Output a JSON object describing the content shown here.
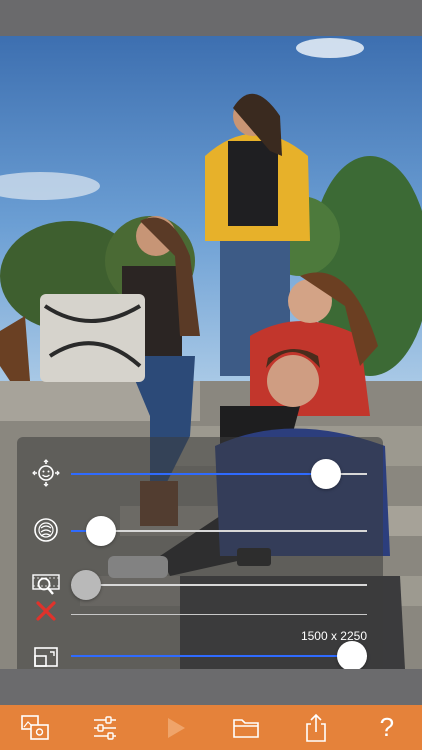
{
  "colors": {
    "toolbar_bg": "#e5823a",
    "slider_fill": "#2f6bff",
    "slider_track": "#d8d8d8",
    "panel_bg": "rgba(60,60,60,0.55)"
  },
  "photo": {
    "icon": "photo-image"
  },
  "sliders": [
    {
      "icon": "face-detect-icon",
      "level": 0.86,
      "enabled": true
    },
    {
      "icon": "skin-smooth-icon",
      "level": 0.1,
      "enabled": true
    },
    {
      "icon": "zoom-crop-icon",
      "level": 0.0,
      "enabled": false
    },
    {
      "icon": "resize-icon",
      "level": 0.95,
      "enabled": true
    }
  ],
  "disabled_marker": "x-mark-icon",
  "dimensions_label": "1500 x 2250",
  "toolbar": {
    "items": [
      "switch-photo-icon",
      "adjust-sliders-icon",
      "play-icon",
      "folder-icon",
      "share-icon",
      "help-icon"
    ],
    "help_label": "?"
  }
}
